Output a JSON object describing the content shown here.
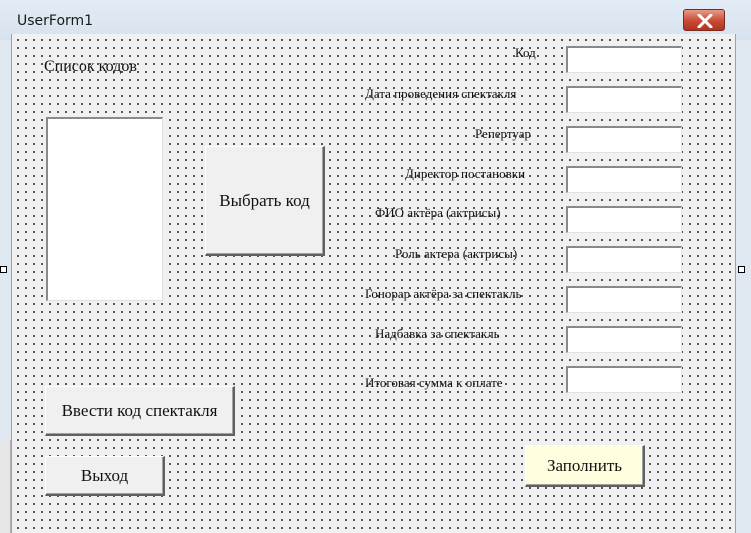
{
  "window": {
    "title": "UserForm1"
  },
  "form": {
    "list_label": "Список кодов",
    "select_button": "Выбрать код",
    "enter_button": "Ввести код спектакля",
    "exit_button": "Выход",
    "fill_button": "Заполнить",
    "fields": [
      {
        "label": "Код",
        "value": ""
      },
      {
        "label": "Дата проведения спектакля",
        "value": ""
      },
      {
        "label": "Репертуар",
        "value": ""
      },
      {
        "label": "Директор постановки",
        "value": ""
      },
      {
        "label": "ФИО актёра (актрисы)",
        "value": ""
      },
      {
        "label": "Роль актера (актрисы)",
        "value": ""
      },
      {
        "label": "Гонорар актёра за спектакль",
        "value": ""
      },
      {
        "label": "Надбавка за спектакль",
        "value": ""
      },
      {
        "label": "Итоговая сумма к оплате",
        "value": ""
      }
    ]
  }
}
